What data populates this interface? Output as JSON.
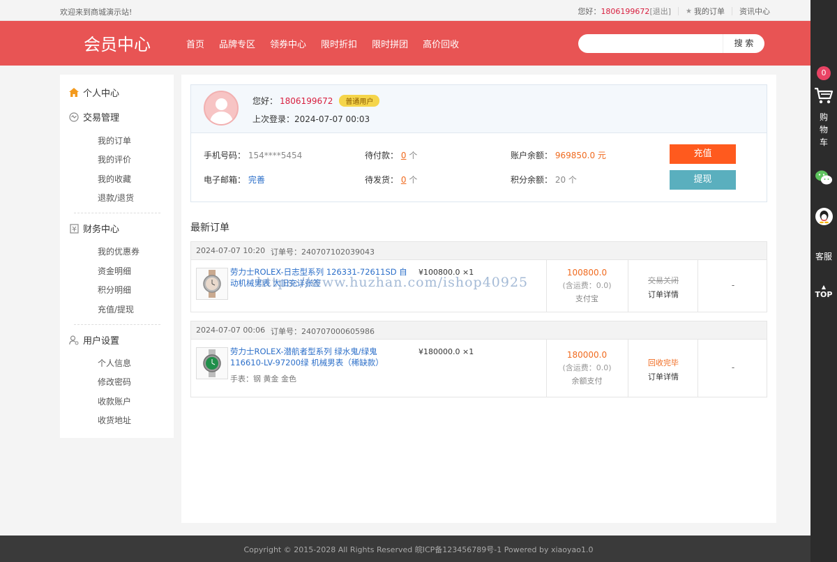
{
  "topbar": {
    "welcome": "欢迎来到商城演示站!",
    "hello": "您好：",
    "user": "1806199672",
    "logout": "[退出]",
    "my_orders": "我的订单",
    "news": "资讯中心"
  },
  "header": {
    "brand": "会员中心",
    "nav": [
      "首页",
      "品牌专区",
      "领券中心",
      "限时折扣",
      "限时拼团",
      "高价回收"
    ],
    "search_placeholder": "",
    "search_button": "搜 索"
  },
  "sidebar": {
    "personal": "个人中心",
    "trade": {
      "title": "交易管理",
      "items": [
        "我的订单",
        "我的评价",
        "我的收藏",
        "退款/退货"
      ]
    },
    "finance": {
      "title": "财务中心",
      "items": [
        "我的优惠券",
        "资金明细",
        "积分明细",
        "充值/提现"
      ]
    },
    "settings": {
      "title": "用户设置",
      "items": [
        "个人信息",
        "修改密码",
        "收款账户",
        "收货地址"
      ]
    }
  },
  "profile": {
    "hello": "您好：",
    "name": "1806199672",
    "level": "普通用户",
    "last_login": "上次登录：2024-07-07 00:03",
    "phone_label": "手机号码：",
    "phone": "154****5454",
    "email_label": "电子邮箱：",
    "email": "完善",
    "pending_pay_label": "待付款：",
    "pending_pay": "0",
    "pending_ship_label": "待发货：",
    "pending_ship": "0",
    "unit": " 个",
    "balance_label": "账户余额：",
    "balance": "969850.0 元",
    "points_label": "积分余额：",
    "points": "20 个",
    "recharge": "充值",
    "withdraw": "提现"
  },
  "orders_title": "最新订单",
  "orders": [
    {
      "date": "2024-07-07 10:20",
      "no": "订单号：240707102039043",
      "title": "劳力士ROLEX-日志型系列 126331-72611SD 自动机械男表 大旧充详张签",
      "spec": "",
      "unit_price": "¥100800.0 ×1",
      "total": "100800.0",
      "shipping": "(含运费：0.0)",
      "pay": "支付宝",
      "status": "交易关闭",
      "detail": "订单详情",
      "action": "-"
    },
    {
      "date": "2024-07-07 00:06",
      "no": "订单号：240707000605986",
      "title": "劳力士ROLEX-潜航者型系列 绿水鬼/绿鬼 116610-LV-97200绿 机械男表（稀缺款）",
      "spec": "手表：钢 黄金 金色",
      "unit_price": "¥180000.0 ×1",
      "total": "180000.0",
      "shipping": "(含运费：0.0)",
      "pay": "余额支付",
      "status": "回收完毕",
      "detail": "订单详情",
      "action": "-"
    }
  ],
  "watermark": "https://www.huzhan.com/ishop40925",
  "footer": "Copyright © 2015-2028 All Rights Reserved 皖ICP备123456789号-1   Powered by xiaoyao1.0",
  "rightbar": {
    "cart_count": "0",
    "cart_label": "购物车",
    "service": "客服",
    "top": "TOP"
  }
}
